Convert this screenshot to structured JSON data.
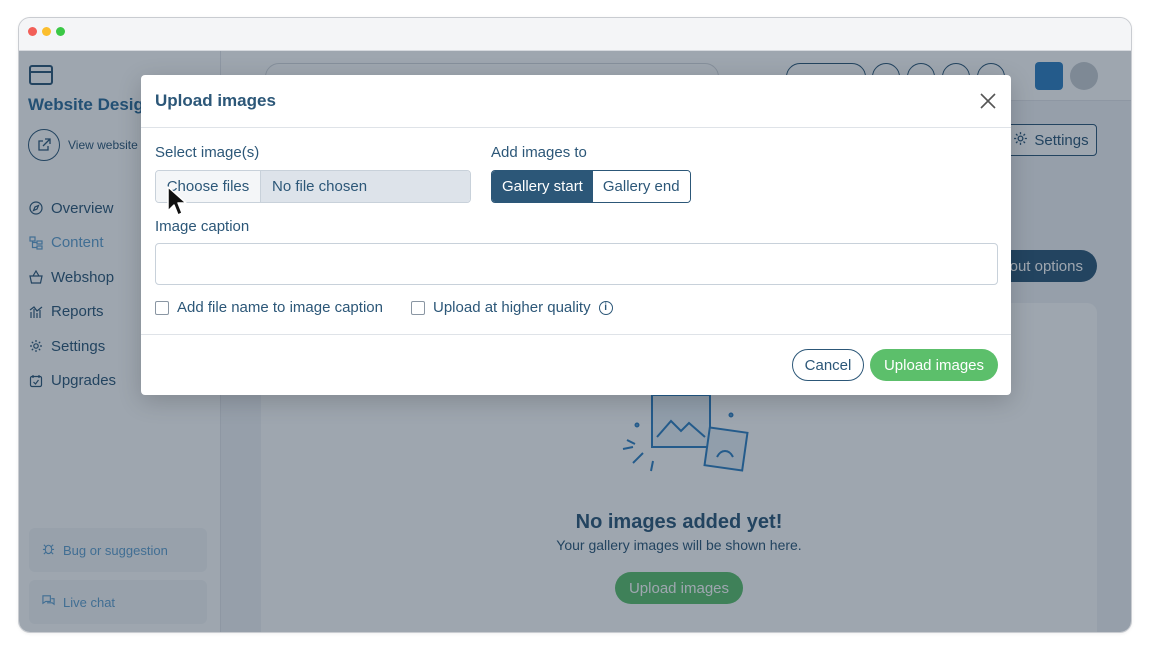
{
  "window": {
    "dots": [
      "#f25f58",
      "#fbbe2e",
      "#3bc846"
    ]
  },
  "sidebar": {
    "brand": "Website Design",
    "view_website": "View website",
    "items": [
      {
        "label": "Overview",
        "icon": "compass-icon"
      },
      {
        "label": "Content",
        "icon": "sitemap-icon",
        "active": true
      },
      {
        "label": "Webshop",
        "icon": "basket-icon"
      },
      {
        "label": "Reports",
        "icon": "chart-icon"
      },
      {
        "label": "Settings",
        "icon": "gear-icon"
      },
      {
        "label": "Upgrades",
        "icon": "upgrade-icon"
      }
    ],
    "bug_label": "Bug or suggestion",
    "chat_label": "Live chat"
  },
  "content": {
    "settings_label": "Settings",
    "layout_options_label": "Layout options",
    "empty_title": "No images added yet!",
    "empty_subtitle": "Your gallery images will be shown here.",
    "empty_upload_label": "Upload images"
  },
  "modal": {
    "title": "Upload images",
    "select_label": "Select image(s)",
    "choose_files": "Choose files",
    "no_file": "No file chosen",
    "add_to_label": "Add images to",
    "gallery_start": "Gallery start",
    "gallery_end": "Gallery end",
    "selected_position": "Gallery start",
    "caption_label": "Image caption",
    "caption_value": "",
    "opt_filename": "Add file name to image caption",
    "opt_quality": "Upload at higher quality",
    "cancel": "Cancel",
    "upload": "Upload images"
  },
  "colors": {
    "primary": "#2c5778",
    "accent": "#5cbf6b",
    "link": "#5f9fcf"
  }
}
